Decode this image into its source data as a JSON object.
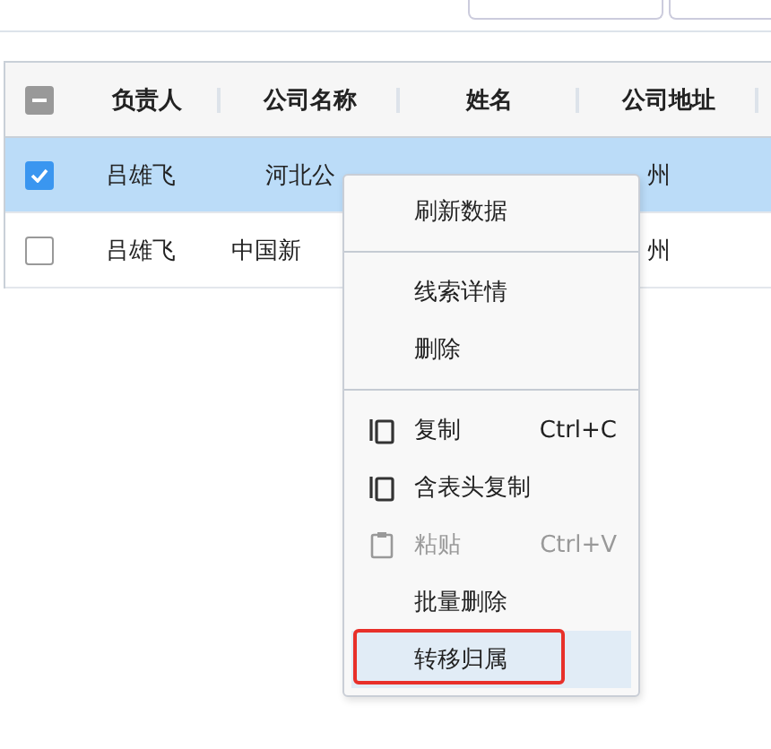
{
  "toolbar": {
    "buttons": [
      {
        "kind": "button"
      },
      {
        "kind": "button"
      }
    ]
  },
  "table": {
    "header_checkbox": {
      "indeterminate": true
    },
    "columns": [
      "负责人",
      "公司名称",
      "姓名",
      "公司地址"
    ],
    "rows": [
      {
        "selected": true,
        "owner": "吕雄飞",
        "company": "河北公",
        "address": "州"
      },
      {
        "selected": false,
        "owner": "吕雄飞",
        "company": "中国新",
        "address": "州"
      }
    ]
  },
  "context_menu": {
    "items": [
      {
        "kind": "item",
        "label": "刷新数据",
        "selected": false,
        "disabled": false
      },
      {
        "kind": "separator"
      },
      {
        "kind": "item",
        "label": "线索详情",
        "selected": false,
        "disabled": false
      },
      {
        "kind": "item",
        "label": "删除",
        "selected": false,
        "disabled": false
      },
      {
        "kind": "separator"
      },
      {
        "kind": "copy",
        "label": "复制",
        "shortcut": "Ctrl+C",
        "selected": false,
        "disabled": false
      },
      {
        "kind": "copy",
        "label": "含表头复制",
        "selected": false,
        "disabled": false
      },
      {
        "kind": "paste",
        "label": "粘贴",
        "shortcut": "Ctrl+V",
        "selected": false,
        "disabled": true
      },
      {
        "kind": "item",
        "label": "批量删除",
        "selected": false,
        "disabled": false
      },
      {
        "kind": "item",
        "label": "转移归属",
        "selected": true,
        "disabled": false,
        "outlined": true
      }
    ]
  }
}
